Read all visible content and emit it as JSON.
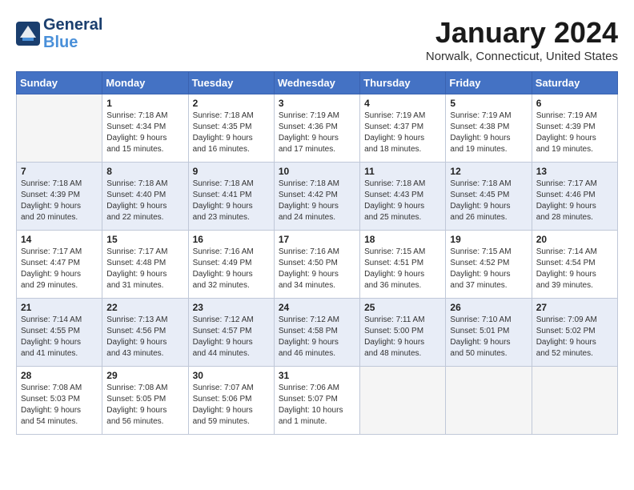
{
  "header": {
    "logo_line1": "General",
    "logo_line2": "Blue",
    "month_title": "January 2024",
    "location": "Norwalk, Connecticut, United States"
  },
  "days_of_week": [
    "Sunday",
    "Monday",
    "Tuesday",
    "Wednesday",
    "Thursday",
    "Friday",
    "Saturday"
  ],
  "weeks": [
    [
      {
        "day": "",
        "info": ""
      },
      {
        "day": "1",
        "info": "Sunrise: 7:18 AM\nSunset: 4:34 PM\nDaylight: 9 hours\nand 15 minutes."
      },
      {
        "day": "2",
        "info": "Sunrise: 7:18 AM\nSunset: 4:35 PM\nDaylight: 9 hours\nand 16 minutes."
      },
      {
        "day": "3",
        "info": "Sunrise: 7:19 AM\nSunset: 4:36 PM\nDaylight: 9 hours\nand 17 minutes."
      },
      {
        "day": "4",
        "info": "Sunrise: 7:19 AM\nSunset: 4:37 PM\nDaylight: 9 hours\nand 18 minutes."
      },
      {
        "day": "5",
        "info": "Sunrise: 7:19 AM\nSunset: 4:38 PM\nDaylight: 9 hours\nand 19 minutes."
      },
      {
        "day": "6",
        "info": "Sunrise: 7:19 AM\nSunset: 4:39 PM\nDaylight: 9 hours\nand 19 minutes."
      }
    ],
    [
      {
        "day": "7",
        "info": "Sunrise: 7:18 AM\nSunset: 4:39 PM\nDaylight: 9 hours\nand 20 minutes."
      },
      {
        "day": "8",
        "info": "Sunrise: 7:18 AM\nSunset: 4:40 PM\nDaylight: 9 hours\nand 22 minutes."
      },
      {
        "day": "9",
        "info": "Sunrise: 7:18 AM\nSunset: 4:41 PM\nDaylight: 9 hours\nand 23 minutes."
      },
      {
        "day": "10",
        "info": "Sunrise: 7:18 AM\nSunset: 4:42 PM\nDaylight: 9 hours\nand 24 minutes."
      },
      {
        "day": "11",
        "info": "Sunrise: 7:18 AM\nSunset: 4:43 PM\nDaylight: 9 hours\nand 25 minutes."
      },
      {
        "day": "12",
        "info": "Sunrise: 7:18 AM\nSunset: 4:45 PM\nDaylight: 9 hours\nand 26 minutes."
      },
      {
        "day": "13",
        "info": "Sunrise: 7:17 AM\nSunset: 4:46 PM\nDaylight: 9 hours\nand 28 minutes."
      }
    ],
    [
      {
        "day": "14",
        "info": "Sunrise: 7:17 AM\nSunset: 4:47 PM\nDaylight: 9 hours\nand 29 minutes."
      },
      {
        "day": "15",
        "info": "Sunrise: 7:17 AM\nSunset: 4:48 PM\nDaylight: 9 hours\nand 31 minutes."
      },
      {
        "day": "16",
        "info": "Sunrise: 7:16 AM\nSunset: 4:49 PM\nDaylight: 9 hours\nand 32 minutes."
      },
      {
        "day": "17",
        "info": "Sunrise: 7:16 AM\nSunset: 4:50 PM\nDaylight: 9 hours\nand 34 minutes."
      },
      {
        "day": "18",
        "info": "Sunrise: 7:15 AM\nSunset: 4:51 PM\nDaylight: 9 hours\nand 36 minutes."
      },
      {
        "day": "19",
        "info": "Sunrise: 7:15 AM\nSunset: 4:52 PM\nDaylight: 9 hours\nand 37 minutes."
      },
      {
        "day": "20",
        "info": "Sunrise: 7:14 AM\nSunset: 4:54 PM\nDaylight: 9 hours\nand 39 minutes."
      }
    ],
    [
      {
        "day": "21",
        "info": "Sunrise: 7:14 AM\nSunset: 4:55 PM\nDaylight: 9 hours\nand 41 minutes."
      },
      {
        "day": "22",
        "info": "Sunrise: 7:13 AM\nSunset: 4:56 PM\nDaylight: 9 hours\nand 43 minutes."
      },
      {
        "day": "23",
        "info": "Sunrise: 7:12 AM\nSunset: 4:57 PM\nDaylight: 9 hours\nand 44 minutes."
      },
      {
        "day": "24",
        "info": "Sunrise: 7:12 AM\nSunset: 4:58 PM\nDaylight: 9 hours\nand 46 minutes."
      },
      {
        "day": "25",
        "info": "Sunrise: 7:11 AM\nSunset: 5:00 PM\nDaylight: 9 hours\nand 48 minutes."
      },
      {
        "day": "26",
        "info": "Sunrise: 7:10 AM\nSunset: 5:01 PM\nDaylight: 9 hours\nand 50 minutes."
      },
      {
        "day": "27",
        "info": "Sunrise: 7:09 AM\nSunset: 5:02 PM\nDaylight: 9 hours\nand 52 minutes."
      }
    ],
    [
      {
        "day": "28",
        "info": "Sunrise: 7:08 AM\nSunset: 5:03 PM\nDaylight: 9 hours\nand 54 minutes."
      },
      {
        "day": "29",
        "info": "Sunrise: 7:08 AM\nSunset: 5:05 PM\nDaylight: 9 hours\nand 56 minutes."
      },
      {
        "day": "30",
        "info": "Sunrise: 7:07 AM\nSunset: 5:06 PM\nDaylight: 9 hours\nand 59 minutes."
      },
      {
        "day": "31",
        "info": "Sunrise: 7:06 AM\nSunset: 5:07 PM\nDaylight: 10 hours\nand 1 minute."
      },
      {
        "day": "",
        "info": ""
      },
      {
        "day": "",
        "info": ""
      },
      {
        "day": "",
        "info": ""
      }
    ]
  ]
}
